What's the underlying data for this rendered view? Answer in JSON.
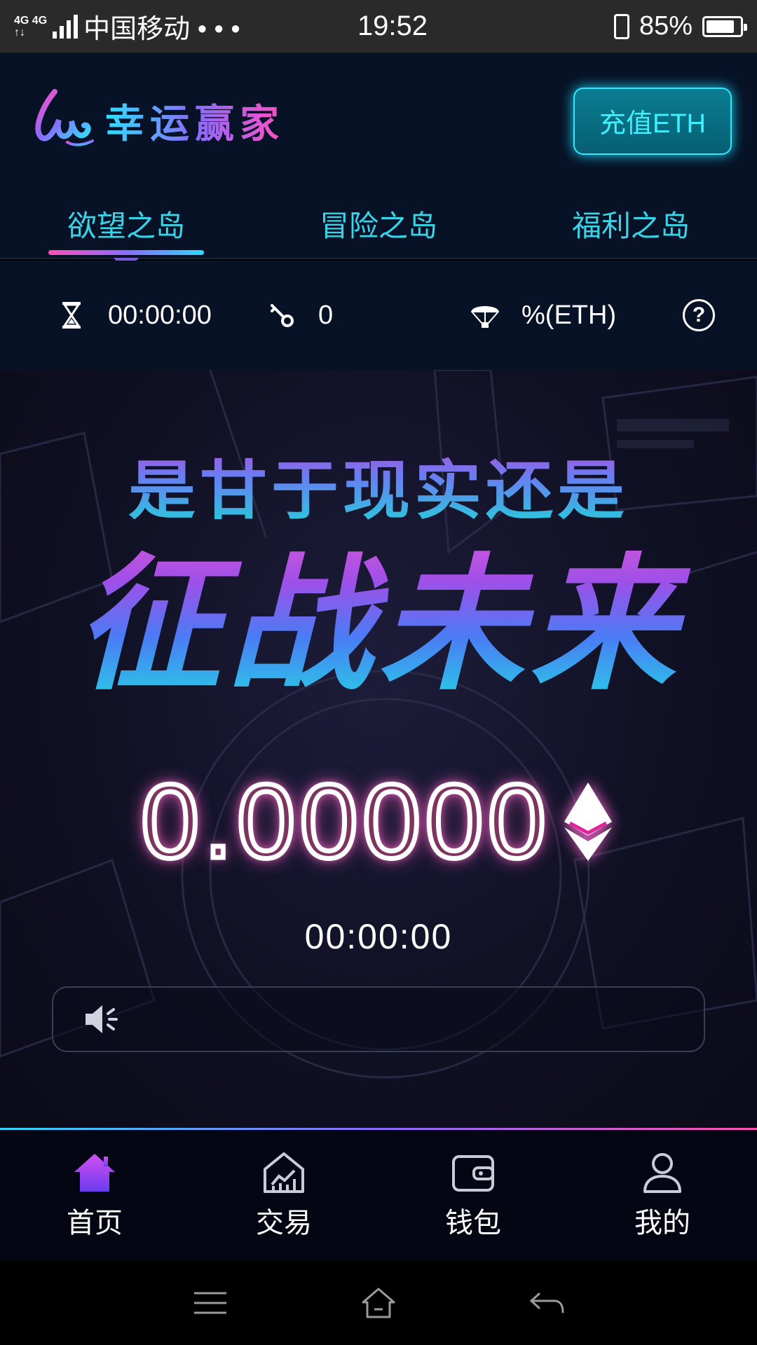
{
  "status_bar": {
    "network_top": "4G 4G",
    "network_bottom": "↑↓",
    "carrier": "中国移动 • • •",
    "time": "19:52",
    "battery": "85%"
  },
  "header": {
    "brand_name": "幸运赢家",
    "recharge_label": "充值ETH"
  },
  "tabs": [
    {
      "label": "欲望之岛",
      "active": true
    },
    {
      "label": "冒险之岛",
      "active": false
    },
    {
      "label": "福利之岛",
      "active": false
    }
  ],
  "info": {
    "timer": "00:00:00",
    "keys": "0",
    "airdrop": "%(ETH)",
    "help": "?"
  },
  "hero": {
    "slogan_small": "是甘于现实还是",
    "slogan_big": "征战未来",
    "amount": "0.00000",
    "countdown": "00:00:00",
    "notice": ""
  },
  "bottom_nav": [
    {
      "label": "首页",
      "icon": "home-icon",
      "active": true
    },
    {
      "label": "交易",
      "icon": "trade-icon",
      "active": false
    },
    {
      "label": "钱包",
      "icon": "wallet-icon",
      "active": false
    },
    {
      "label": "我的",
      "icon": "user-icon",
      "active": false
    }
  ],
  "colors": {
    "accent_cyan": "#39d4e8",
    "accent_pink": "#ff4fb3",
    "accent_purple": "#8b6bff",
    "background": "#071226"
  }
}
